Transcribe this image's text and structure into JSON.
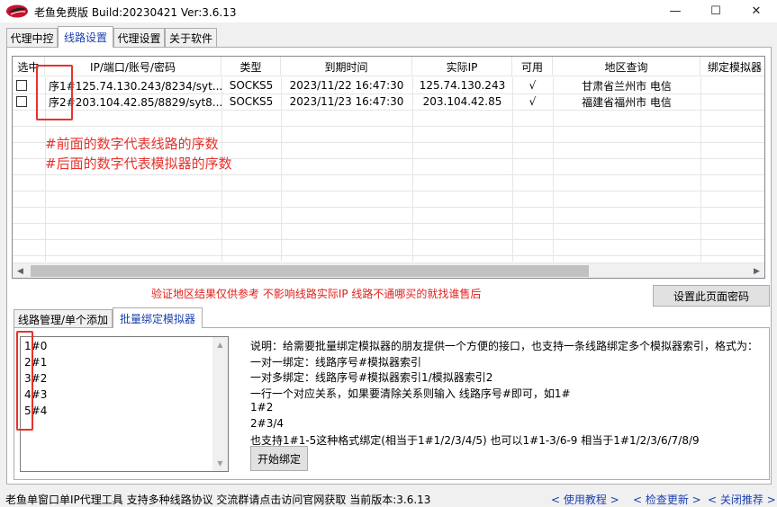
{
  "window": {
    "title": "老鱼免费版 Build:20230421 Ver:3.6.13",
    "controls": {
      "minimize": "—",
      "maximize": "☐",
      "close": "✕"
    }
  },
  "tabs": [
    {
      "label": "代理中控"
    },
    {
      "label": "线路设置"
    },
    {
      "label": "代理设置"
    },
    {
      "label": "关于软件"
    }
  ],
  "active_tab": "线路设置",
  "line_table": {
    "columns": [
      "选中",
      "IP/端口/账号/密码",
      "类型",
      "到期时间",
      "实际IP",
      "可用",
      "地区查询",
      "绑定模拟器"
    ],
    "rows": [
      {
        "checked": false,
        "line": "序1#125.74.130.243/8234/syt...",
        "type": "SOCKS5",
        "expire": "2023/11/22 16:47:30",
        "real_ip": "125.74.130.243",
        "available": "√",
        "region": "甘肃省兰州市  电信",
        "bound": ""
      },
      {
        "checked": false,
        "line": "序2#203.104.42.85/8829/syt8...",
        "type": "SOCKS5",
        "expire": "2023/11/23 16:47:30",
        "real_ip": "203.104.42.85",
        "available": "√",
        "region": "福建省福州市  电信",
        "bound": ""
      }
    ]
  },
  "annotations": {
    "line1": "#前面的数字代表线路的序数",
    "line2": "#后面的数字代表模拟器的序数"
  },
  "notice": "验证地区结果仅供参考 不影响线路实际IP 线路不通哪买的就找谁售后",
  "set_password_button": "设置此页面密码",
  "sub_tabs": [
    {
      "label": "线路管理/单个添加"
    },
    {
      "label": "批量绑定模拟器"
    }
  ],
  "active_sub_tab": "批量绑定模拟器",
  "bind_input_lines": [
    "1#0",
    "2#1",
    "3#2",
    "4#3",
    "5#4"
  ],
  "instructions": [
    "说明：给需要批量绑定模拟器的朋友提供一个方便的接口，也支持一条线路绑定多个模拟器索引，格式为：",
    "一对一绑定：线路序号#模拟器索引",
    "一对多绑定：线路序号#模拟器索引1/模拟器索引2",
    "一行一个对应关系，如果要清除关系则输入 线路序号#即可，如1#",
    "1#2",
    "2#3/4",
    "也支持1#1-5这种格式绑定(相当于1#1/2/3/4/5) 也可以1#1-3/6-9 相当于1#1/2/3/6/7/8/9"
  ],
  "start_bind_button": "开始绑定",
  "statusbar": {
    "text": "老鱼单窗口单IP代理工具 支持多种线路协议 交流群请点击访问官网获取  当前版本:3.6.13",
    "links": [
      "< 使用教程 >",
      "< 检查更新 >",
      "< 关闭推荐 >"
    ]
  }
}
